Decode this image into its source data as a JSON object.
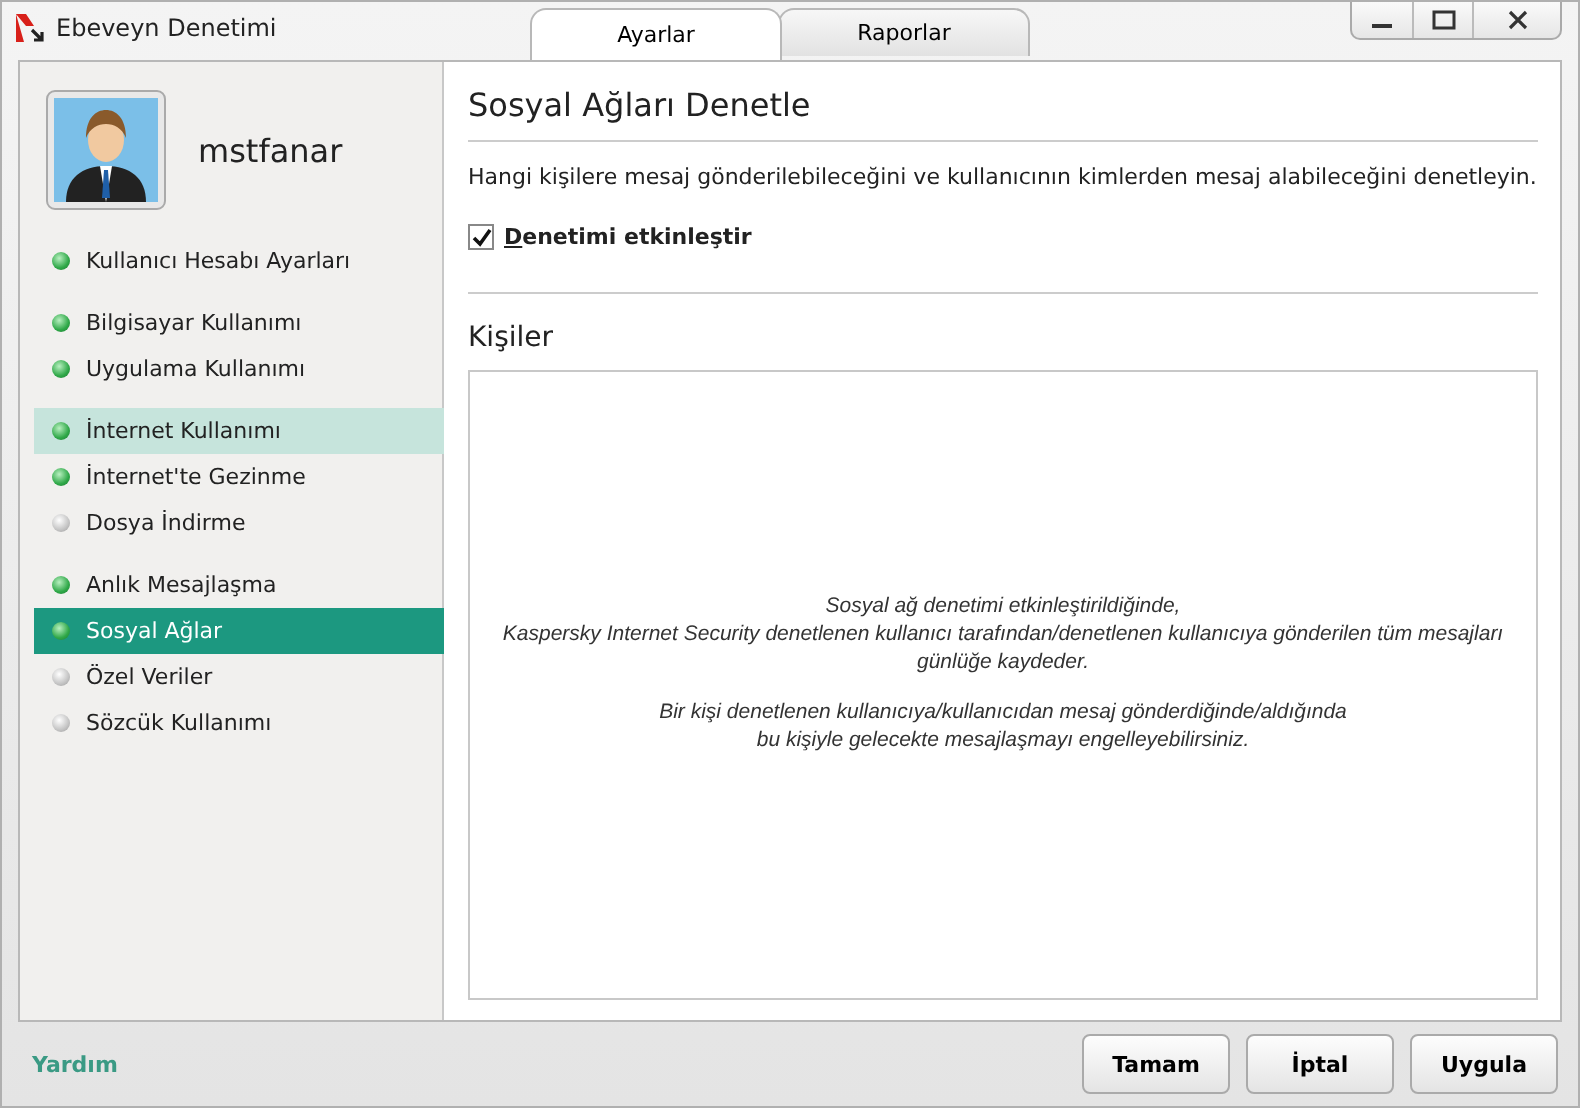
{
  "window": {
    "title": "Ebeveyn Denetimi"
  },
  "tabs": [
    {
      "label": "Ayarlar",
      "selected": true
    },
    {
      "label": "Raporlar",
      "selected": false
    }
  ],
  "user": {
    "name": "mstfanar"
  },
  "sidebar": {
    "groups": [
      {
        "items": [
          {
            "label": "Kullanıcı Hesabı Ayarları",
            "enabled": true,
            "selected": false,
            "hovered": false
          }
        ]
      },
      {
        "items": [
          {
            "label": "Bilgisayar Kullanımı",
            "enabled": true,
            "selected": false,
            "hovered": false
          },
          {
            "label": "Uygulama Kullanımı",
            "enabled": true,
            "selected": false,
            "hovered": false
          }
        ]
      },
      {
        "items": [
          {
            "label": "İnternet Kullanımı",
            "enabled": true,
            "selected": false,
            "hovered": true
          },
          {
            "label": "İnternet'te Gezinme",
            "enabled": true,
            "selected": false,
            "hovered": false
          },
          {
            "label": "Dosya İndirme",
            "enabled": false,
            "selected": false,
            "hovered": false
          }
        ]
      },
      {
        "items": [
          {
            "label": "Anlık Mesajlaşma",
            "enabled": true,
            "selected": false,
            "hovered": false
          },
          {
            "label": "Sosyal Ağlar",
            "enabled": true,
            "selected": true,
            "hovered": false
          },
          {
            "label": "Özel Veriler",
            "enabled": false,
            "selected": false,
            "hovered": false
          },
          {
            "label": "Sözcük Kullanımı",
            "enabled": false,
            "selected": false,
            "hovered": false
          }
        ]
      }
    ]
  },
  "content": {
    "title": "Sosyal Ağları Denetle",
    "description": "Hangi kişilere mesaj gönderilebileceğini ve kullanıcının kimlerden mesaj alabileceğini denetleyin.",
    "checkbox": {
      "label": "Denetimi etkinleştir",
      "checked": true
    },
    "section_title": "Kişiler",
    "contacts_messages": [
      "Sosyal ağ denetimi etkinleştirildiğinde,\nKaspersky Internet Security denetlenen kullanıcı tarafından/denetlenen kullanıcıya gönderilen tüm mesajları\ngünlüğe kaydeder.",
      "Bir kişi denetlenen kullanıcıya/kullanıcıdan mesaj gönderdiğinde/aldığında\nbu kişiyle gelecekte mesajlaşmayı engelleyebilirsiniz."
    ]
  },
  "footer": {
    "help_link": "Yardım",
    "buttons": [
      "Tamam",
      "İptal",
      "Uygula"
    ]
  }
}
